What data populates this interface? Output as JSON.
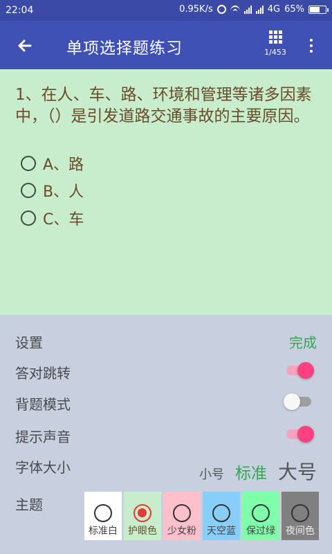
{
  "status_bar": {
    "time": "22:04",
    "network_speed": "0.95K/s",
    "network_type": "4G",
    "battery": "65%",
    "battery_level": 0.65
  },
  "app_bar": {
    "title": "单项选择题练习",
    "question_counter": "1/453",
    "back_icon": "arrow-left-icon",
    "grid_icon": "grid-icon",
    "more_icon": "more-vert-icon"
  },
  "question": {
    "text": "1、在人、车、路、环境和管理等诸多因素中，（）是引发道路交通事故的主要原因。",
    "options": [
      {
        "label": "A、路"
      },
      {
        "label": "B、人"
      },
      {
        "label": "C、车"
      }
    ]
  },
  "settings": {
    "title": "设置",
    "done": "完成",
    "jump_on_correct": {
      "label": "答对跳转",
      "on": true
    },
    "memorize_mode": {
      "label": "背题模式",
      "on": false
    },
    "sound": {
      "label": "提示声音",
      "on": true
    },
    "font_size": {
      "label": "字体大小",
      "options": [
        "小号",
        "标准",
        "大号"
      ],
      "selected": "标准"
    },
    "theme": {
      "label": "主题",
      "options": [
        {
          "name": "标准白",
          "color": "#ffffff",
          "text_color": "#444444"
        },
        {
          "name": "护眼色",
          "color": "#c7edcc",
          "text_color": "#6b4b2a"
        },
        {
          "name": "少女粉",
          "color": "#ffc0cb",
          "text_color": "#444444"
        },
        {
          "name": "天空蓝",
          "color": "#87cefa",
          "text_color": "#444444"
        },
        {
          "name": "保过绿",
          "color": "#7fffaa",
          "text_color": "#444444"
        },
        {
          "name": "夜间色",
          "color": "#808080",
          "text_color": "#eeeeee"
        }
      ],
      "selected": "护眼色"
    }
  },
  "colors": {
    "status_bar": "#3a4aa6",
    "app_bar": "#3f51b5",
    "question_bg": "#c7edcc",
    "settings_bg": "#c8d0e0",
    "accent_green": "#2fa84f",
    "toggle_on": "#ff4081"
  }
}
